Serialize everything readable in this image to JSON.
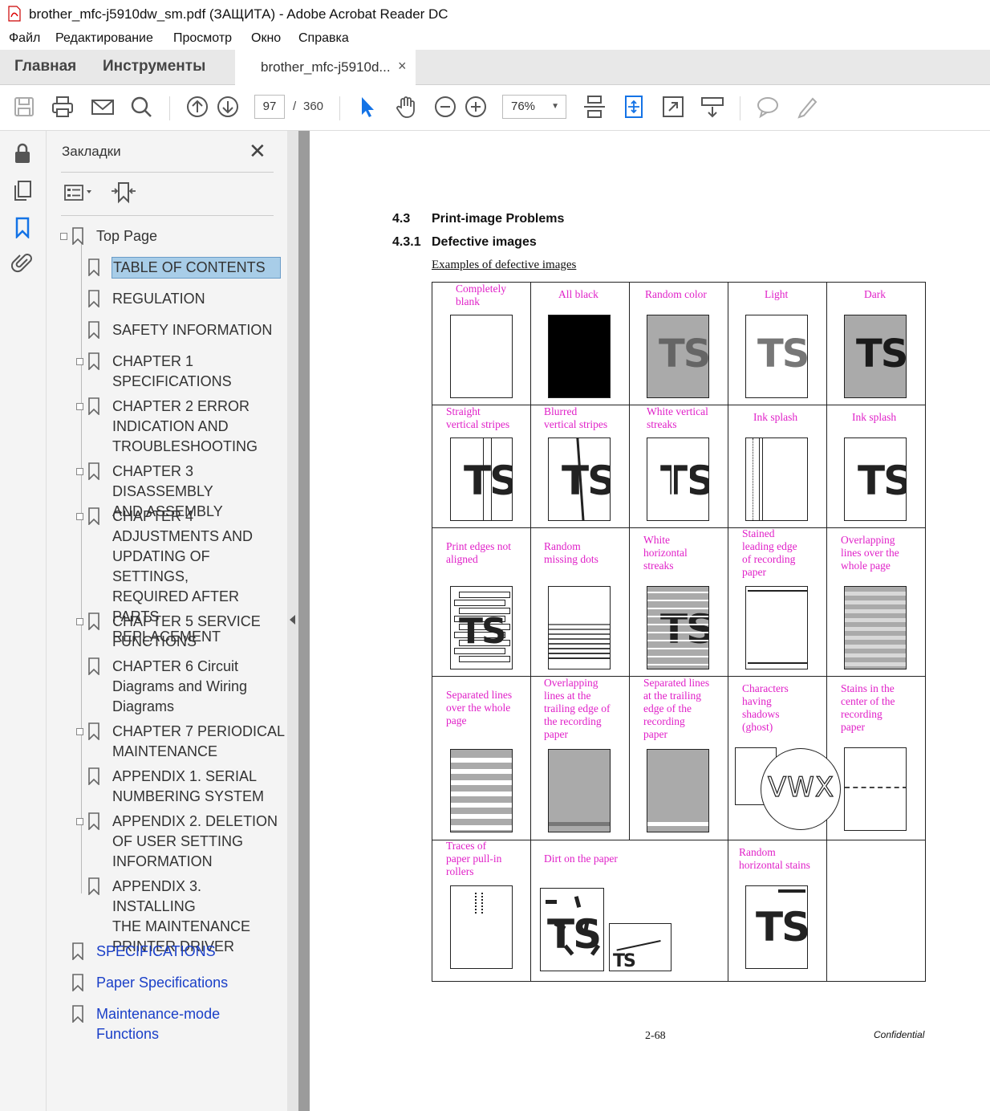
{
  "window": {
    "title": "brother_mfc-j5910dw_sm.pdf (ЗАЩИТА) - Adobe Acrobat Reader DC"
  },
  "menu": [
    "Файл",
    "Редактирование",
    "Просмотр",
    "Окно",
    "Справка"
  ],
  "tabs": {
    "home": "Главная",
    "tools": "Инструменты",
    "document": "brother_mfc-j5910d...",
    "close": "×"
  },
  "toolbar": {
    "page_current": "97",
    "page_separator": "/",
    "page_total": "360",
    "zoom": "76%"
  },
  "bookmarks_panel": {
    "title": "Закладки",
    "close": "✕",
    "items": [
      {
        "label": "Top Page"
      },
      {
        "label": "TABLE OF CONTENTS"
      },
      {
        "label": "REGULATION"
      },
      {
        "label": "SAFETY INFORMATION"
      },
      {
        "label": "CHAPTER 1\nSPECIFICATIONS"
      },
      {
        "label": "CHAPTER 2 ERROR\nINDICATION AND\nTROUBLESHOOTING"
      },
      {
        "label": "CHAPTER 3 DISASSEMBLY\nAND ASSEMBLY"
      },
      {
        "label": "CHAPTER 4\nADJUSTMENTS AND\nUPDATING OF SETTINGS,\nREQUIRED AFTER PARTS\nREPLACEMENT"
      },
      {
        "label": "CHAPTER 5 SERVICE\nFUNCTIONS"
      },
      {
        "label": "CHAPTER 6 Circuit\nDiagrams and Wiring\nDiagrams"
      },
      {
        "label": "CHAPTER 7 PERIODICAL\nMAINTENANCE"
      },
      {
        "label": "APPENDIX 1. SERIAL\nNUMBERING SYSTEM"
      },
      {
        "label": "APPENDIX 2. DELETION\nOF USER SETTING\nINFORMATION"
      },
      {
        "label": "APPENDIX 3. INSTALLING\nTHE MAINTENANCE\nPRINTER DRIVER"
      },
      {
        "label": "SPECIFICATIONS"
      },
      {
        "label": "Paper Specifications"
      },
      {
        "label": "Maintenance-mode\nFunctions"
      }
    ]
  },
  "document": {
    "section_num": "4.3",
    "section_title": "Print-image Problems",
    "subsection_num": "4.3.1",
    "subsection_title": "Defective images",
    "examples_title": "Examples of defective images",
    "sample_text": "TS",
    "ghost_text": "VWX",
    "cells": [
      "Completely\nblank",
      "All black",
      "Random color",
      "Light",
      "Dark",
      "Straight\nvertical stripes",
      "Blurred\nvertical stripes",
      "White vertical\nstreaks",
      "Ink splash",
      "Ink splash",
      "Print edges not\naligned",
      "Random\nmissing dots",
      "White\nhorizontal\nstreaks",
      "Stained\nleading edge\nof recording\npaper",
      "Overlapping\nlines over the\nwhole page",
      "Separated lines\nover the whole\npage",
      "Overlapping\nlines at the\ntrailing edge of\nthe recording\npaper",
      "Separated lines\nat the trailing\nedge of the\nrecording\npaper",
      "Characters\nhaving\nshadows\n(ghost)",
      "Stains in the\ncenter of the\nrecording\npaper",
      "Traces of\npaper pull-in\nrollers",
      "Dirt on the paper",
      "Random\nhorizontal stains"
    ],
    "page_number": "2-68",
    "confidential": "Confidential"
  },
  "colors": {
    "label_magenta": "#e020c8",
    "selected_bookmark": "#a8cde8",
    "link_blue": "#1a3fc8",
    "tool_blue": "#1473e6"
  }
}
